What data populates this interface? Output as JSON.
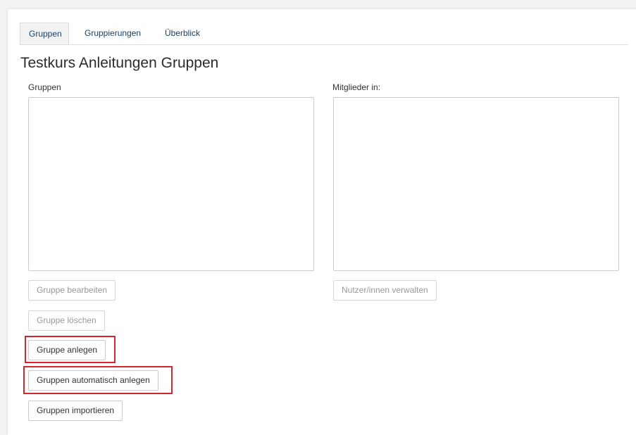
{
  "tabs": [
    {
      "label": "Gruppen",
      "active": true
    },
    {
      "label": "Gruppierungen",
      "active": false
    },
    {
      "label": "Überblick",
      "active": false
    }
  ],
  "page_title": "Testkurs Anleitungen Gruppen",
  "groups_column": {
    "label": "Gruppen",
    "buttons": {
      "edit": "Gruppe bearbeiten",
      "delete": "Gruppe löschen",
      "create": "Gruppe anlegen",
      "auto_create": "Gruppen automatisch anlegen",
      "import": "Gruppen importieren"
    }
  },
  "members_column": {
    "label": "Mitglieder in:",
    "buttons": {
      "manage_users": "Nutzer/innen verwalten"
    }
  },
  "colors": {
    "highlight": "#d9232d",
    "link": "#1d3f66"
  }
}
